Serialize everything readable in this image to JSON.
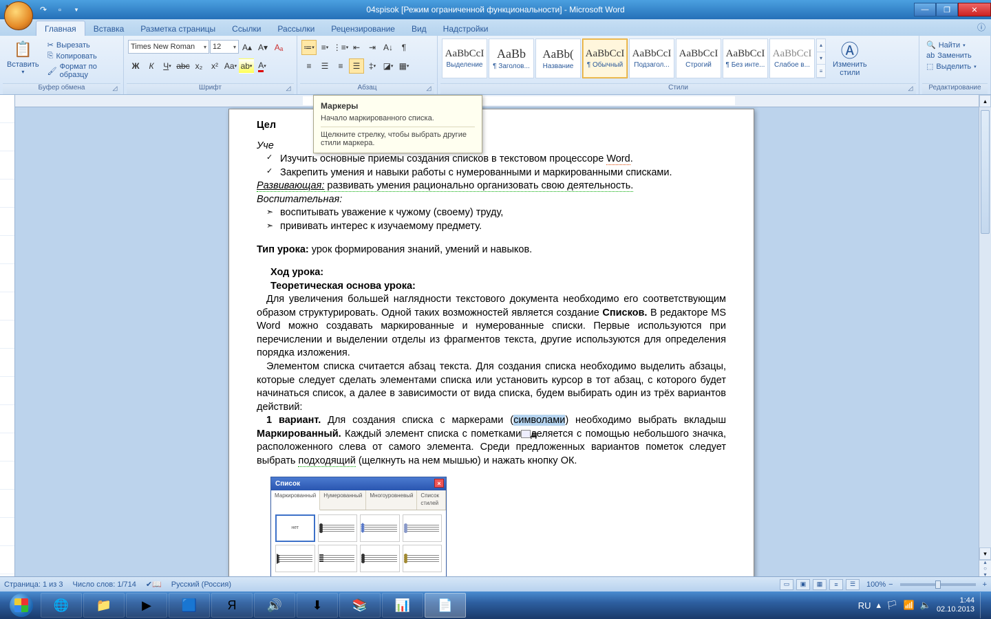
{
  "title": "04spisok [Режим ограниченной функциональности] - Microsoft Word",
  "tabs": {
    "items": [
      "Главная",
      "Вставка",
      "Разметка страницы",
      "Ссылки",
      "Рассылки",
      "Рецензирование",
      "Вид",
      "Надстройки"
    ],
    "active": 0
  },
  "clipboard": {
    "paste": "Вставить",
    "cut": "Вырезать",
    "copy": "Копировать",
    "format_painter": "Формат по образцу",
    "label": "Буфер обмена"
  },
  "font": {
    "name": "Times New Roman",
    "size": "12",
    "label": "Шрифт"
  },
  "paragraph": {
    "label": "Абзац"
  },
  "styles": {
    "label": "Стили",
    "change": "Изменить\nстили",
    "items": [
      {
        "preview": "AaBbCcI",
        "name": "Выделение"
      },
      {
        "preview": "AaBb",
        "name": "¶ Заголов..."
      },
      {
        "preview": "AaBb(",
        "name": "Название"
      },
      {
        "preview": "AaBbCcI",
        "name": "¶ Обычный",
        "sel": true
      },
      {
        "preview": "AaBbCcI",
        "name": "Подзагол..."
      },
      {
        "preview": "AaBbCcI",
        "name": "Строгий"
      },
      {
        "preview": "AaBbCcI",
        "name": "¶ Без инте..."
      },
      {
        "preview": "AaBbCcI",
        "name": "Слабое в..."
      }
    ]
  },
  "editing": {
    "label": "Редактирование",
    "find": "Найти",
    "replace": "Заменить",
    "select": "Выделить"
  },
  "tooltip": {
    "title": "Маркеры",
    "line1": "Начало маркированного списка.",
    "line2": "Щелкните стрелку, чтобы выбрать другие стили маркера."
  },
  "doc": {
    "celi": "Цел",
    "uche": "Уче",
    "bul1": "Изучить основные приемы создания списков в текстовом процессоре ",
    "word": "Word",
    "bul2": "Закрепить умения и навыки работы с нумерованными и маркированными списками.",
    "razv_l": "Развивающая:",
    "razv_r": " развивать умения рационально организовать свою деятельность.",
    "vosp": "Воспитательная:",
    "arr1": "воспитывать уважение к  чужому (своему) труду,",
    "arr2": "прививать интерес к изучаемому предмету.",
    "tip_l": "Тип урока:",
    "tip_r": " урок формирования знаний, умений и навыков.",
    "hod": "Ход урока:",
    "teor": "Теоретическая основа урока:",
    "p1a": "Для увеличения большей наглядности текстового документа необходимо его соответствующим образом структурировать. Одной  таких возможностей является создание ",
    "p1b": "Списков.",
    "p1c": " В редакторе MS Word можно создавать маркированные и нумерованные списки. Первые используются при перечислении и выделении отделы из фрагментов текста, другие используются для определения порядка изложения.",
    "p2": "Элементом списка считается абзац текста. Для создания списка необходимо выделить абзацы, которые следует сделать элементами списка или установить курсор в тот абзац, с которого будет начинаться список, а далее в зависимости от вида списка, будем выбирать один из трёх вариантов действий:",
    "p3a": "1 вариант.",
    "p3b": " Для создания списка с маркерами (",
    "p3c": "символами",
    "p3d": ") необходимо выбрать вкладыш ",
    "p3e": "Маркированный.",
    "p3f": " Каждый элемент списка с пометками",
    "p3g": "деляется с помощью небольшого значка, расположенного слева от самого элемента. Среди предложенных вариантов пометок следует выбрать ",
    "p3h": "подходящий",
    "p3i": " (щелкнуть на нем мышью) и нажать кнопку ОК."
  },
  "dlg": {
    "title": "Список",
    "tabs": [
      "Маркированный",
      "Нумерованный",
      "Многоуровневый",
      "Список стилей"
    ],
    "none": "нет"
  },
  "status": {
    "page": "Страница: 1 из 3",
    "words": "Число слов: 1/714",
    "lang": "Русский (Россия)",
    "zoom": "100%"
  },
  "tray": {
    "lang": "RU",
    "time": "1:44",
    "date": "02.10.2013"
  }
}
